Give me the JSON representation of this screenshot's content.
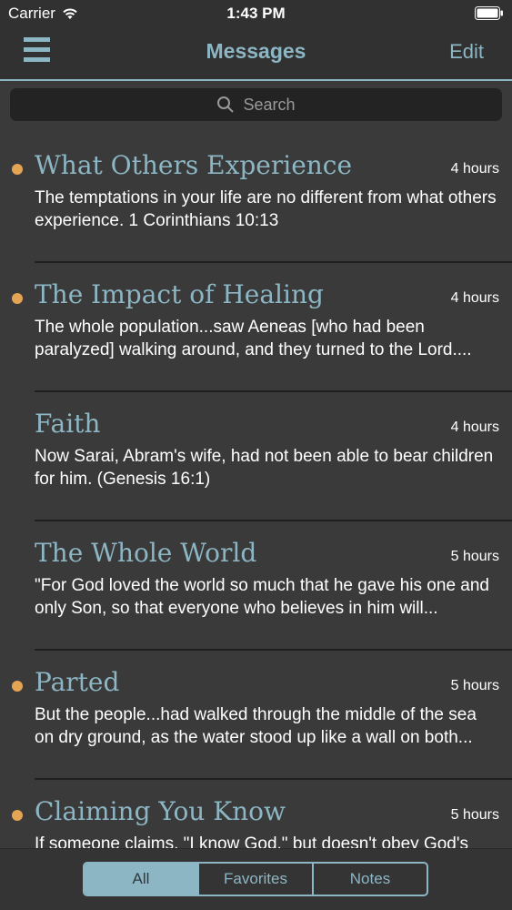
{
  "status_bar": {
    "carrier": "Carrier",
    "time": "1:43 PM"
  },
  "nav": {
    "title": "Messages",
    "edit_label": "Edit"
  },
  "search": {
    "placeholder": "Search"
  },
  "messages": [
    {
      "title": "What Others Experience",
      "time": "4 hours",
      "body": "The temptations in your life are no different from what others experience. 1 Corinthians 10:13",
      "unread": true
    },
    {
      "title": "The Impact of Healing",
      "time": "4 hours",
      "body": "The whole population...saw Aeneas [who had been paralyzed] walking around, and they turned to the Lord....",
      "unread": true
    },
    {
      "title": "Faith",
      "time": "4 hours",
      "body": "Now Sarai, Abram's wife, had not been able to bear children for him. (Genesis 16:1)",
      "unread": false
    },
    {
      "title": "The Whole World",
      "time": "5 hours",
      "body": "\"For God loved the world so much that he gave his one and only Son, so that everyone who believes in him will...",
      "unread": false
    },
    {
      "title": "Parted",
      "time": "5 hours",
      "body": "But the people...had walked through the middle of the sea on dry ground, as the water stood up like a wall on both...",
      "unread": true
    },
    {
      "title": "Claiming You Know",
      "time": "5 hours",
      "body": "If someone claims, \"I know God,\" but doesn't obey God's commandments,",
      "unread": true
    }
  ],
  "tabs": [
    {
      "label": "All",
      "selected": true
    },
    {
      "label": "Favorites",
      "selected": false
    },
    {
      "label": "Notes",
      "selected": false
    }
  ],
  "colors": {
    "accent": "#8db6c4",
    "unread_dot": "#e3a454",
    "background": "#3a3a3a"
  }
}
